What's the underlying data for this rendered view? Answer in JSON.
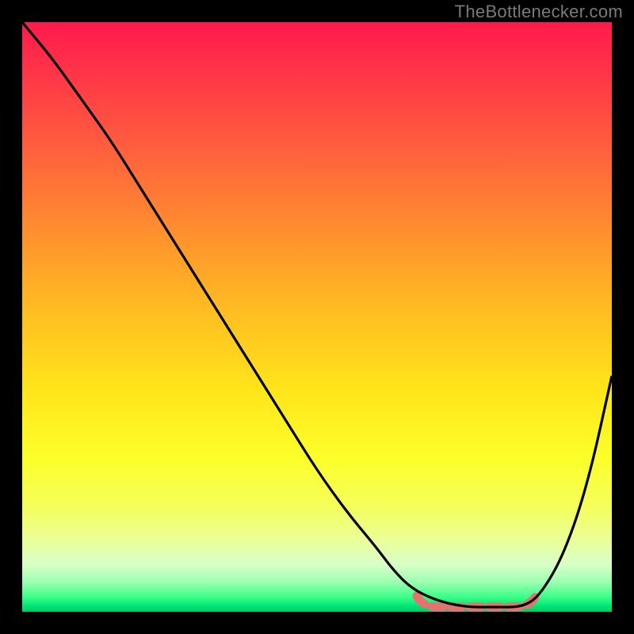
{
  "watermark": "TheBottlenecker.com",
  "colors": {
    "curve": "#000000",
    "highlight": "#e6716e",
    "background_top": "#ff1a4d",
    "background_bottom": "#00c864"
  },
  "chart_data": {
    "type": "line",
    "title": "",
    "xlabel": "",
    "ylabel": "",
    "xlim": [
      0,
      100
    ],
    "ylim": [
      0,
      100
    ],
    "series": [
      {
        "name": "bottleneck-curve",
        "x": [
          0,
          5,
          10,
          15,
          20,
          25,
          30,
          35,
          40,
          45,
          50,
          55,
          60,
          63,
          66,
          70,
          75,
          80,
          85,
          88,
          92,
          96,
          100
        ],
        "values": [
          100,
          94,
          87,
          80,
          72,
          64,
          56,
          48,
          40,
          32,
          24,
          17,
          11,
          7,
          4,
          2,
          0.8,
          0.8,
          0.8,
          3,
          10,
          22,
          40
        ]
      }
    ],
    "annotations": [
      {
        "name": "optimal-range-highlight",
        "x_start": 68,
        "x_end": 86,
        "y": 0.8
      }
    ]
  }
}
